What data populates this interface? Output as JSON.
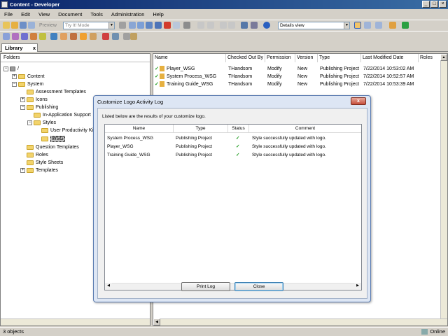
{
  "window": {
    "title": "Content - Developer"
  },
  "menu": [
    "File",
    "Edit",
    "View",
    "Document",
    "Tools",
    "Administration",
    "Help"
  ],
  "toolbar": {
    "preview_label": "Preview",
    "mode_combo": "Try It! Mode",
    "view_combo": "Details view"
  },
  "library_tab": {
    "label": "Library",
    "close": "x"
  },
  "folders": {
    "header": "Folders",
    "items": [
      {
        "label": "/"
      },
      {
        "label": "Content"
      },
      {
        "label": "System"
      },
      {
        "label": "Assessment Templates"
      },
      {
        "label": "Icons"
      },
      {
        "label": "Publishing"
      },
      {
        "label": "In-Application Support"
      },
      {
        "label": "Styles"
      },
      {
        "label": "User Productivity Kit"
      },
      {
        "label": "WSG"
      },
      {
        "label": "Question Templates"
      },
      {
        "label": "Roles"
      },
      {
        "label": "Style Sheets"
      },
      {
        "label": "Templates"
      }
    ]
  },
  "list": {
    "columns": [
      "Name",
      "Checked Out By",
      "Permission",
      "Version",
      "Type",
      "Last Modified Date",
      "Roles"
    ],
    "rows": [
      {
        "name": "Player_WSG",
        "checked_out_by": "THandsom",
        "permission": "Modify",
        "version": "New",
        "type": "Publishing Project",
        "modified": "7/22/2014 10:53:02 AM"
      },
      {
        "name": "System Process_WSG",
        "checked_out_by": "THandsom",
        "permission": "Modify",
        "version": "New",
        "type": "Publishing Project",
        "modified": "7/22/2014 10:52:57 AM"
      },
      {
        "name": "Training Guide_WSG",
        "checked_out_by": "THandsom",
        "permission": "Modify",
        "version": "New",
        "type": "Publishing Project",
        "modified": "7/22/2014 10:53:39 AM"
      }
    ]
  },
  "dialog": {
    "title": "Customize Logo Activity Log",
    "close": "x",
    "message": "Listed below are the results of your customize logo.",
    "columns": [
      "Name",
      "Type",
      "Status",
      "Comment"
    ],
    "rows": [
      {
        "name": "System Process_WSG",
        "type": "Publishing Project",
        "status": "✓",
        "comment": "Style successfully updated with logo."
      },
      {
        "name": "Player_WSG",
        "type": "Publishing Project",
        "status": "✓",
        "comment": "Style successfully updated with logo."
      },
      {
        "name": "Training Guide_WSG",
        "type": "Publishing Project",
        "status": "✓",
        "comment": "Style successfully updated with logo."
      }
    ],
    "print_button": "Print Log",
    "close_button": "Close"
  },
  "status": {
    "left": "3 objects",
    "right": "Online"
  },
  "colors": {
    "title_bar": "#0a246a",
    "check": "#1a9a1a",
    "folder": "#f2d36b",
    "dialog_border": "#5a7bb0"
  }
}
